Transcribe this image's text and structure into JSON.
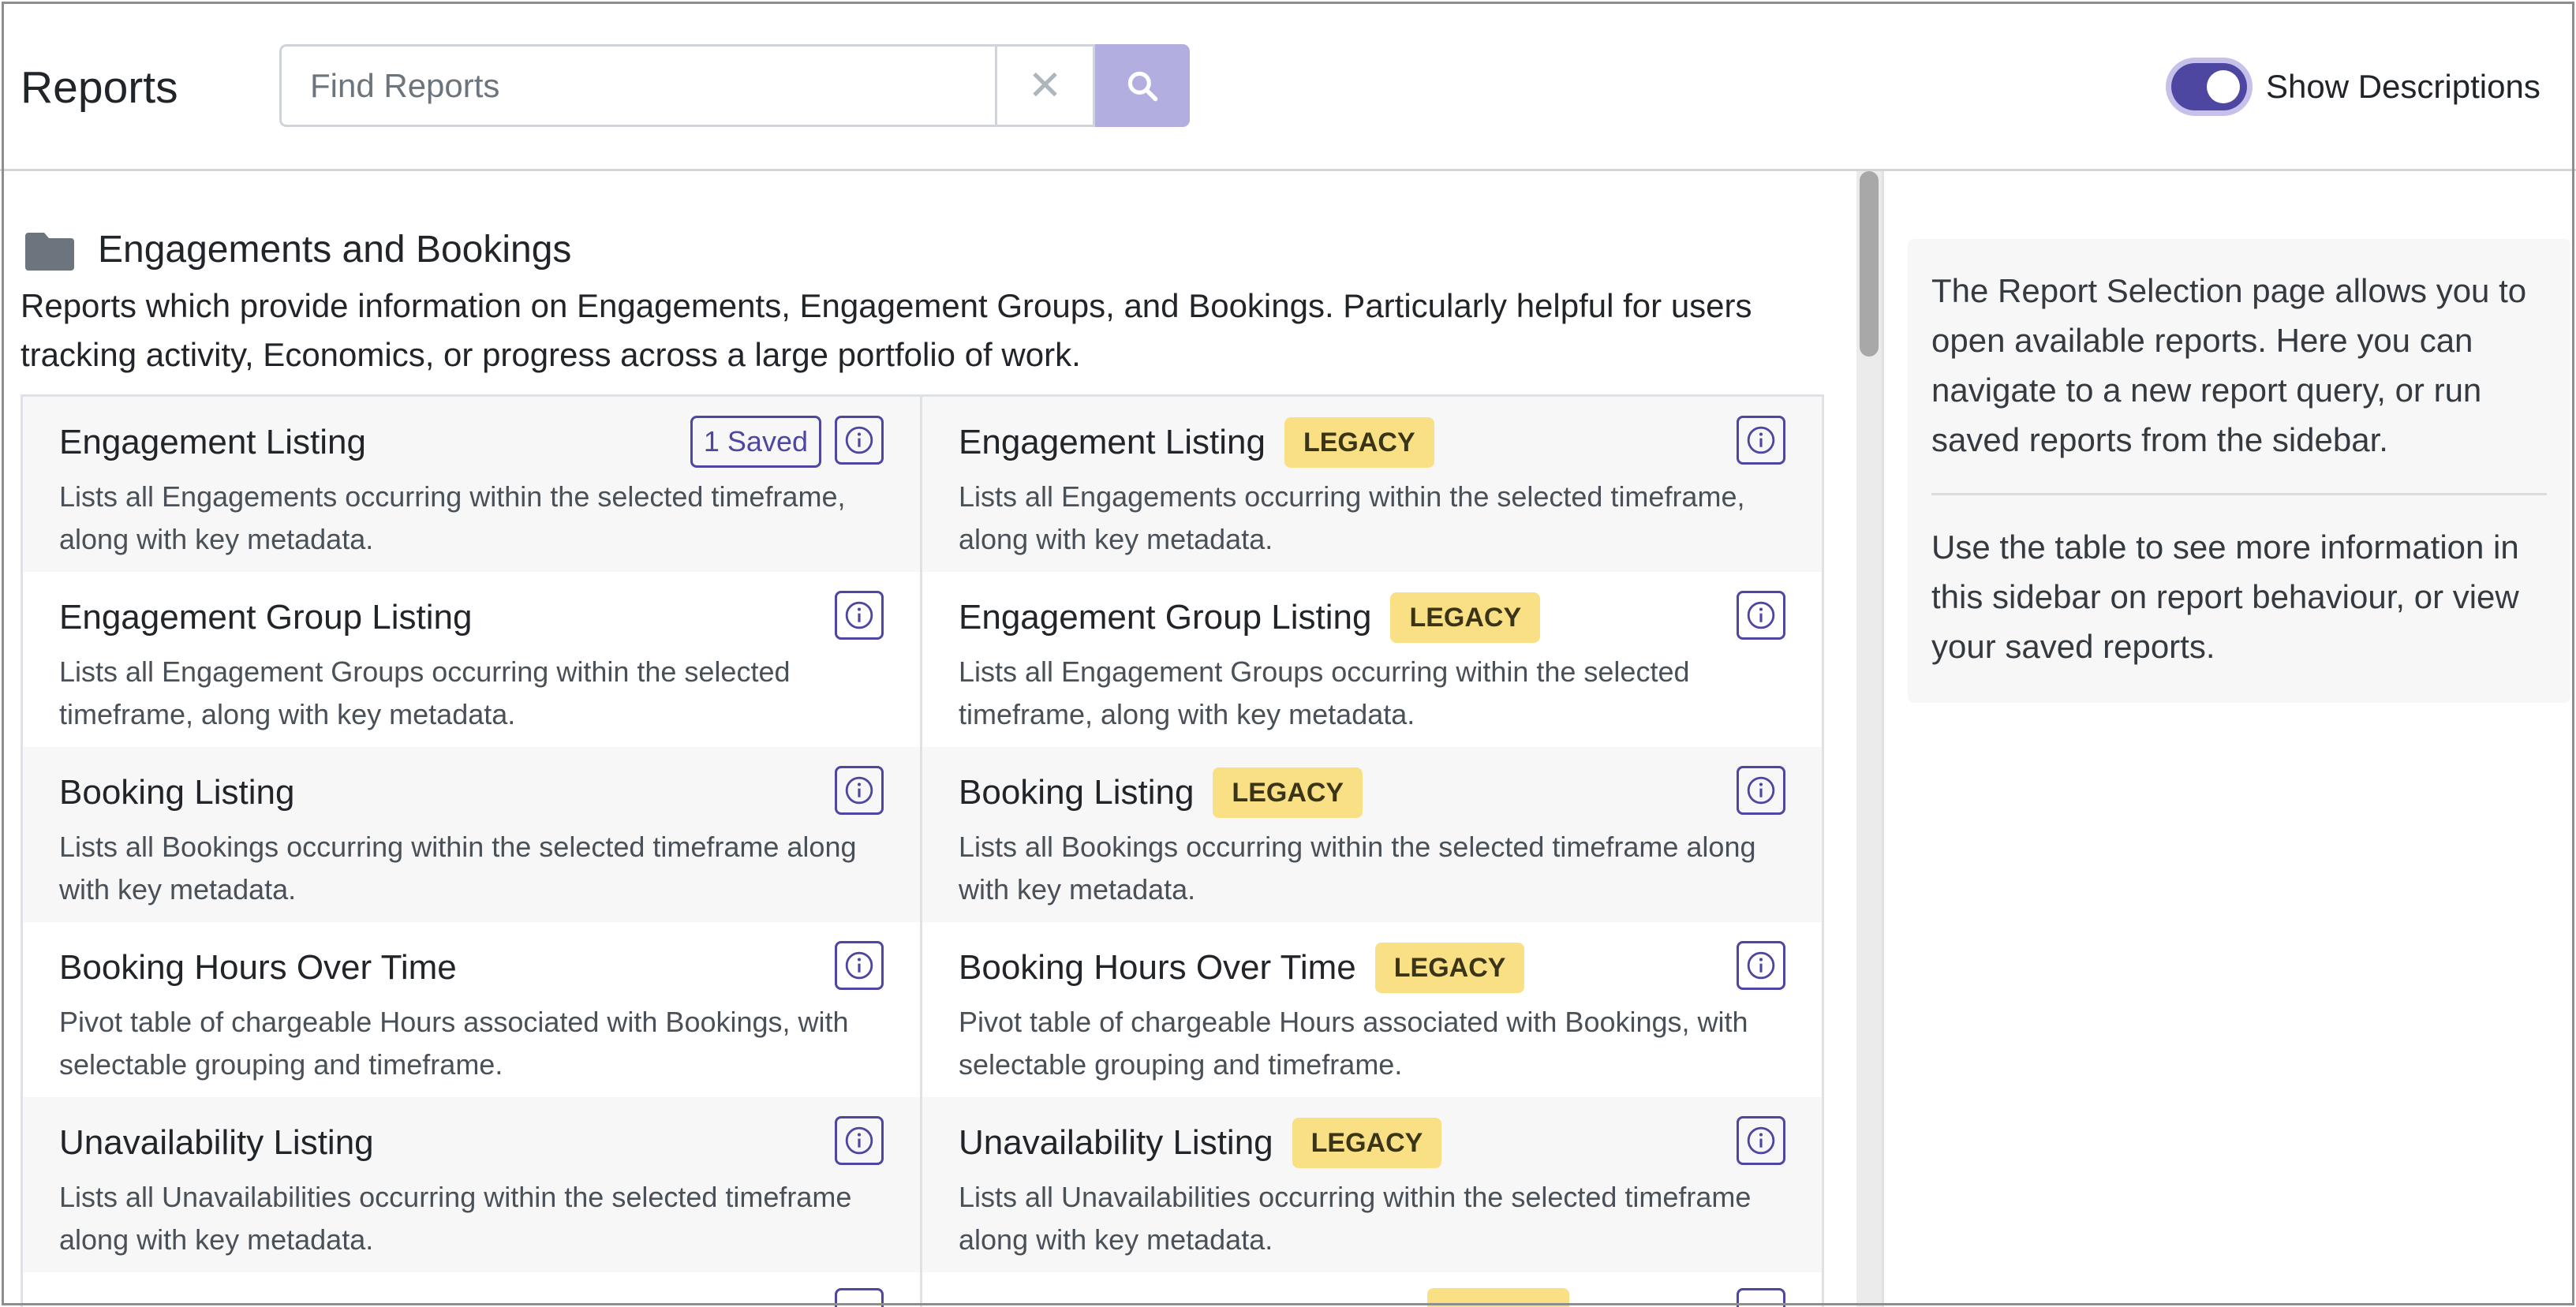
{
  "header": {
    "title": "Reports",
    "search": {
      "placeholder": "Find Reports",
      "value": ""
    },
    "toggle": {
      "label": "Show Descriptions",
      "checked": true
    }
  },
  "section": {
    "title": "Engagements and Bookings",
    "description": "Reports which provide information on Engagements, Engagement Groups, and Bookings. Particularly helpful for users tracking activity, Economics, or progress across a large portfolio of work."
  },
  "reports": [
    {
      "left": {
        "title": "Engagement Listing",
        "description": "Lists all Engagements occurring within the selected timeframe, along with key metadata.",
        "saved": "1 Saved"
      },
      "right": {
        "title": "Engagement Listing",
        "badge": "LEGACY",
        "description": "Lists all Engagements occurring within the selected timeframe, along with key metadata."
      }
    },
    {
      "left": {
        "title": "Engagement Group Listing",
        "description": "Lists all Engagement Groups occurring within the selected timeframe, along with key metadata."
      },
      "right": {
        "title": "Engagement Group Listing",
        "badge": "LEGACY",
        "description": "Lists all Engagement Groups occurring within the selected timeframe, along with key metadata."
      }
    },
    {
      "left": {
        "title": "Booking Listing",
        "description": "Lists all Bookings occurring within the selected timeframe along with key metadata."
      },
      "right": {
        "title": "Booking Listing",
        "badge": "LEGACY",
        "description": "Lists all Bookings occurring within the selected timeframe along with key metadata."
      }
    },
    {
      "left": {
        "title": "Booking Hours Over Time",
        "description": "Pivot table of chargeable Hours associated with Bookings, with selectable grouping and timeframe."
      },
      "right": {
        "title": "Booking Hours Over Time",
        "badge": "LEGACY",
        "description": "Pivot table of chargeable Hours associated with Bookings, with selectable grouping and timeframe."
      }
    },
    {
      "left": {
        "title": "Unavailability Listing",
        "description": "Lists all Unavailabilities occurring within the selected timeframe along with key metadata."
      },
      "right": {
        "title": "Unavailability Listing",
        "badge": "LEGACY",
        "description": "Lists all Unavailabilities occurring within the selected timeframe along with key metadata."
      }
    }
  ],
  "sidebar": {
    "paragraph1": "The Report Selection page allows you to open available reports. Here you can navigate to a new report query, or run saved reports from the sidebar.",
    "paragraph2": "Use the table to see more information in this sidebar on report behaviour, or view your saved reports."
  },
  "icons": {
    "folder": "folder-icon",
    "info": "info-icon",
    "search": "search-icon",
    "clear": "clear-icon"
  },
  "colors": {
    "accent": "#4e47a2",
    "search_button": "#b3aee0",
    "legacy_badge": "#f9e085",
    "folder_icon": "#6c757d"
  }
}
